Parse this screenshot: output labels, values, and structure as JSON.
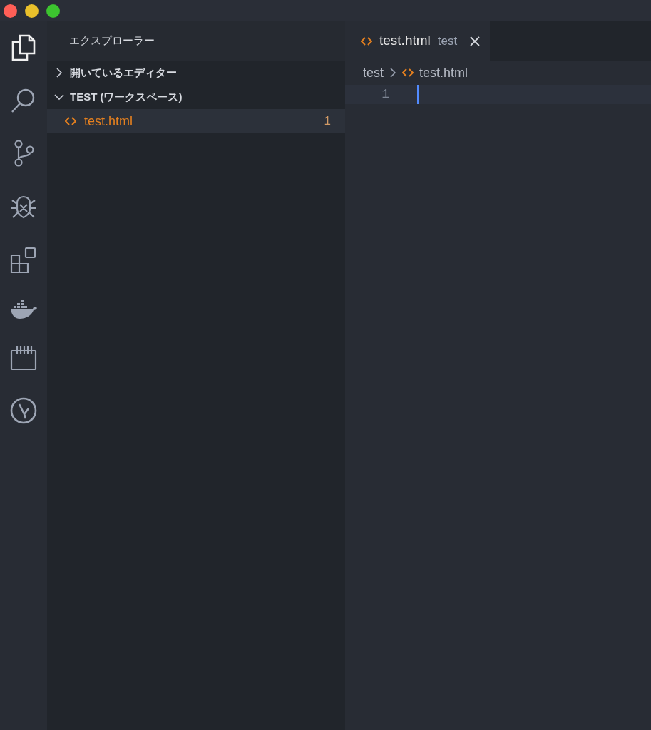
{
  "activity_bar": [
    {
      "kind": "files",
      "selected": true
    },
    {
      "kind": "search",
      "selected": false
    },
    {
      "kind": "git",
      "selected": false
    },
    {
      "kind": "debug",
      "selected": false
    },
    {
      "kind": "extensions",
      "selected": false
    },
    {
      "kind": "docker",
      "selected": false
    },
    {
      "kind": "board",
      "selected": false
    },
    {
      "kind": "gitgraph",
      "selected": false
    }
  ],
  "sidebar": {
    "title": "エクスプローラー",
    "sections": [
      {
        "label": "開いているエディター",
        "expanded": false
      },
      {
        "label": "TEST (ワークスペース)",
        "expanded": true,
        "children": [
          {
            "label": "test.html",
            "badge": "1",
            "selected": true
          }
        ]
      }
    ]
  },
  "tabs": [
    {
      "label": "test.html",
      "description": "test",
      "selected": true
    }
  ],
  "breadcrumbs": [
    "test",
    "test.html"
  ],
  "editor": {
    "line_numbers": [
      "1"
    ]
  }
}
